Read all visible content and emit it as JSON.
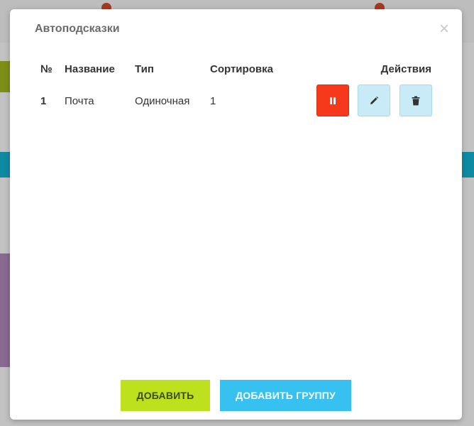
{
  "modal": {
    "title": "Автоподсказки",
    "close_symbol": "×"
  },
  "table": {
    "headers": {
      "num": "№",
      "name": "Название",
      "type": "Тип",
      "sort": "Сортировка",
      "actions": "Действия"
    },
    "rows": [
      {
        "num": "1",
        "name": "Почта",
        "type": "Одиночная",
        "sort": "1"
      }
    ],
    "row_action_icons": [
      "pause-icon",
      "pencil-icon",
      "trash-icon"
    ]
  },
  "footer": {
    "add_label": "ДОБАВИТЬ",
    "add_group_label": "ДОБАВИТЬ ГРУППУ"
  },
  "colors": {
    "pause_button": "#f5391a",
    "action_button": "#c9ebf7",
    "add_button": "#bde21d",
    "add_group_button": "#36c1f0"
  }
}
